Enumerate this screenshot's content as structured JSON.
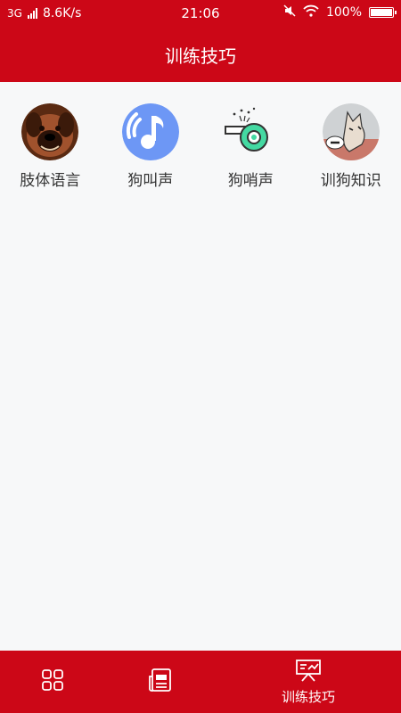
{
  "status_bar": {
    "network_type": "3G",
    "speed": "8.6K/s",
    "time": "21:06",
    "battery": "100%",
    "battery_level": 1.0,
    "icons": [
      "signal-icon",
      "mute-icon",
      "wifi-icon",
      "battery-icon"
    ]
  },
  "header": {
    "title": "训练技巧"
  },
  "features": [
    {
      "label": "肢体语言",
      "icon": "dog-face-icon"
    },
    {
      "label": "狗叫声",
      "icon": "music-note-icon"
    },
    {
      "label": "狗哨声",
      "icon": "whistle-icon"
    },
    {
      "label": "训狗知识",
      "icon": "dog-knowledge-icon"
    }
  ],
  "bottom_nav": {
    "items": [
      {
        "label": "",
        "icon": "grid-icon"
      },
      {
        "label": "",
        "icon": "news-icon"
      },
      {
        "label": "训练技巧",
        "icon": "training-board-icon",
        "active": true
      }
    ]
  },
  "colors": {
    "brand_red": "#cc0717",
    "background": "#f7f8f9",
    "music_blue": "#6d97f5",
    "whistle_green": "#44d9a2"
  }
}
